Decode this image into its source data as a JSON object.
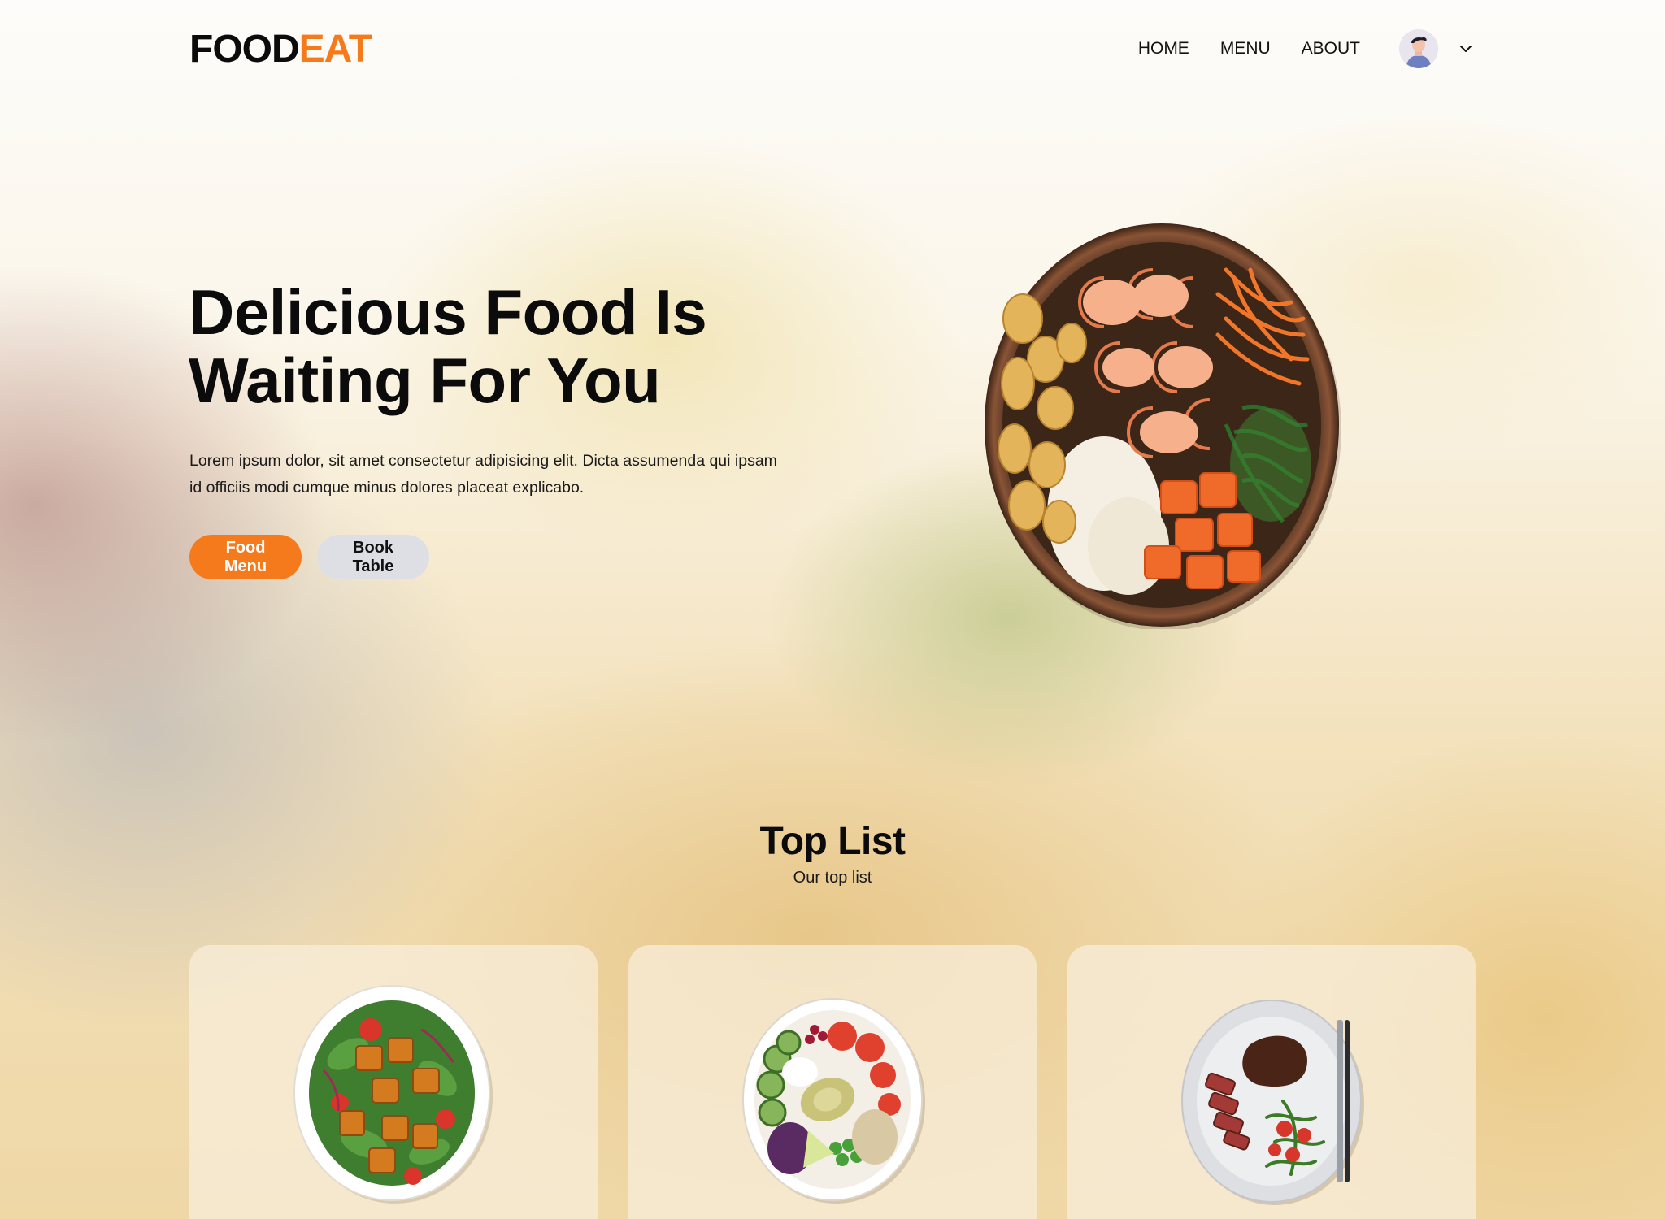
{
  "header": {
    "logo_primary": "FOOD",
    "logo_accent": "EAT",
    "nav": [
      {
        "label": "HOME"
      },
      {
        "label": "MENU"
      },
      {
        "label": "ABOUT"
      }
    ]
  },
  "hero": {
    "title_line1": "Delicious Food Is",
    "title_line2": "Waiting For You",
    "description": "Lorem ipsum dolor, sit amet consectetur adipisicing elit. Dicta assumenda qui ipsam id officiis modi cumque minus dolores placeat explicabo.",
    "primary_button": "Food Menu",
    "secondary_button": "Book Table"
  },
  "top_list": {
    "title": "Top List",
    "subtitle": "Our top list",
    "cards": [
      {
        "icon": "tofu-salad-plate-icon"
      },
      {
        "icon": "veggie-bowl-icon"
      },
      {
        "icon": "steak-plate-icon"
      }
    ]
  },
  "colors": {
    "accent": "#f57a1c",
    "secondary_button": "#dedfe5",
    "text": "#0b0b0b"
  }
}
